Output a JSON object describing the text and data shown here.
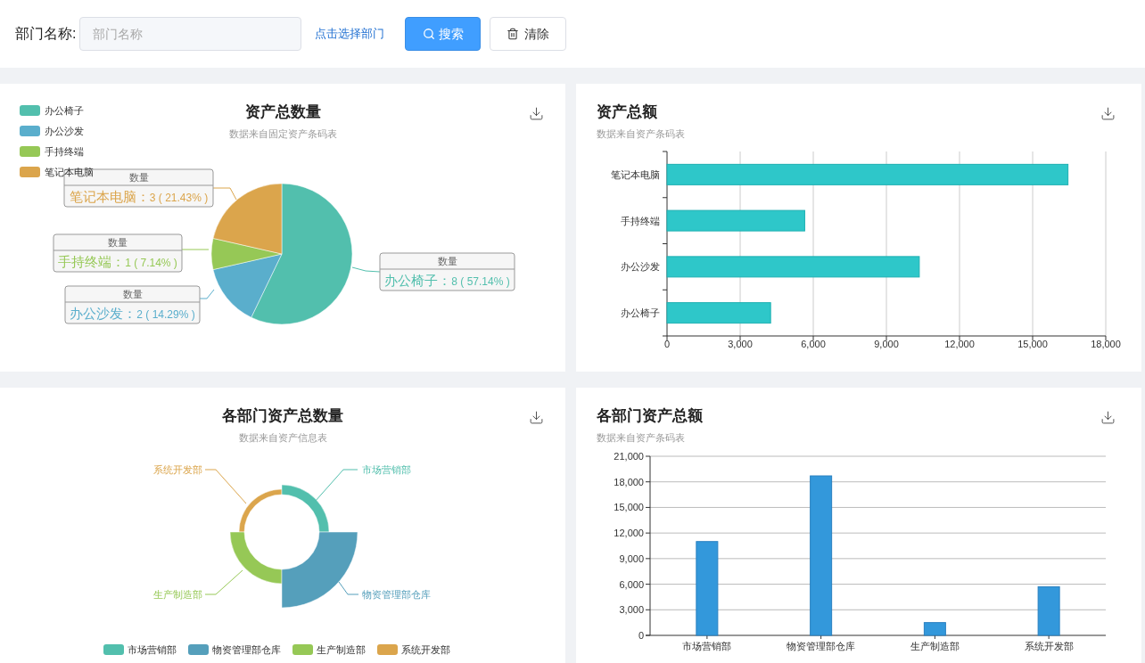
{
  "search_bar": {
    "label": "部门名称:",
    "field": {
      "placeholder": "部门名称"
    },
    "select_link": "点击选择部门",
    "buttons": [
      {
        "kind": "primary",
        "label": "搜索"
      },
      {
        "kind": "plain",
        "label": "清除"
      }
    ]
  },
  "panels": [
    {
      "title": "资产总数量",
      "subtitle": "数据来自固定资产条码表",
      "slices": [
        {
          "color": "#52bfad"
        },
        {
          "color": "#5aaecc"
        },
        {
          "color": "#96c856"
        },
        {
          "color": "#dba54c"
        }
      ],
      "callouts": [
        {
          "header": "数量",
          "name": "笔记本电脑：",
          "value": "3 ( 21.43% )",
          "color": "#dba54c"
        },
        {
          "header": "数量",
          "name": "手持终端：",
          "value": "1 ( 7.14% )",
          "color": "#96c856"
        },
        {
          "header": "数量",
          "name": "办公椅子：",
          "value": "8 ( 57.14% )",
          "color": "#52bfad"
        },
        {
          "header": "数量",
          "name": "办公沙发：",
          "value": "2 ( 14.29% )",
          "color": "#5aaecc"
        }
      ],
      "chart_data": {
        "type": "pie",
        "legend": "top-left",
        "categories": [
          "办公椅子",
          "办公沙发",
          "手持终端",
          "笔记本电脑"
        ],
        "series": [
          {
            "values": [
              57.14,
              14.29,
              7.14,
              21.43
            ]
          }
        ]
      }
    },
    {
      "title": "资产总额",
      "subtitle": "数据来自资产条码表",
      "chart_data": {
        "type": "bar",
        "orientation": "horizontal",
        "grid": true,
        "categories": [
          "笔记本电脑",
          "手持终端",
          "办公沙发",
          "办公椅子"
        ],
        "series": [
          {
            "color": "#2ec7c9",
            "values": [
              16450,
              5650,
              10350,
              4250
            ]
          }
        ],
        "xlim": [
          0,
          18000
        ],
        "xticks": [
          {
            "value": 0,
            "label": "0"
          },
          {
            "value": 3000,
            "label": "3,000"
          },
          {
            "value": 6000,
            "label": "6,000"
          },
          {
            "value": 9000,
            "label": "9,000"
          },
          {
            "value": 12000,
            "label": "12,000"
          },
          {
            "value": 15000,
            "label": "15,000"
          },
          {
            "value": 18000,
            "label": "18,000"
          }
        ]
      }
    },
    {
      "kind": "rose",
      "title": "各部门资产总数量",
      "subtitle": "数据来自资产信息表",
      "slices": [
        {
          "label": "系统开发部",
          "color": "#dba54c"
        },
        {
          "label": "市场营销部",
          "color": "#52bfad"
        },
        {
          "label": "生产制造部",
          "color": "#96c856"
        },
        {
          "label": "物资管理部仓库",
          "color": "#559fbb"
        }
      ],
      "legend": [
        {
          "label": "市场营销部",
          "color": "#52bfad"
        },
        {
          "label": "物资管理部仓库",
          "color": "#559fbb"
        },
        {
          "label": "生产制造部",
          "color": "#96c856"
        },
        {
          "label": "系统开发部",
          "color": "#dba54c"
        }
      ]
    },
    {
      "title": "各部门资产总额",
      "subtitle": "数据来自资产条码表",
      "chart_data": {
        "type": "bar",
        "orientation": "vertical",
        "grid": true,
        "categories": [
          "市场营销部",
          "物资管理部仓库",
          "生产制造部",
          "系统开发部"
        ],
        "series": [
          {
            "color": "#3398db",
            "values": [
              11000,
              18700,
              1500,
              5700
            ]
          }
        ],
        "ylim": [
          0,
          21000
        ],
        "yticks": [
          {
            "value": 0,
            "label": "0"
          },
          {
            "value": 3000,
            "label": "3,000"
          },
          {
            "value": 6000,
            "label": "6,000"
          },
          {
            "value": 9000,
            "label": "9,000"
          },
          {
            "value": 12000,
            "label": "12,000"
          },
          {
            "value": 15000,
            "label": "15,000"
          },
          {
            "value": 18000,
            "label": "18,000"
          },
          {
            "value": 21000,
            "label": "21,000"
          }
        ]
      }
    }
  ]
}
